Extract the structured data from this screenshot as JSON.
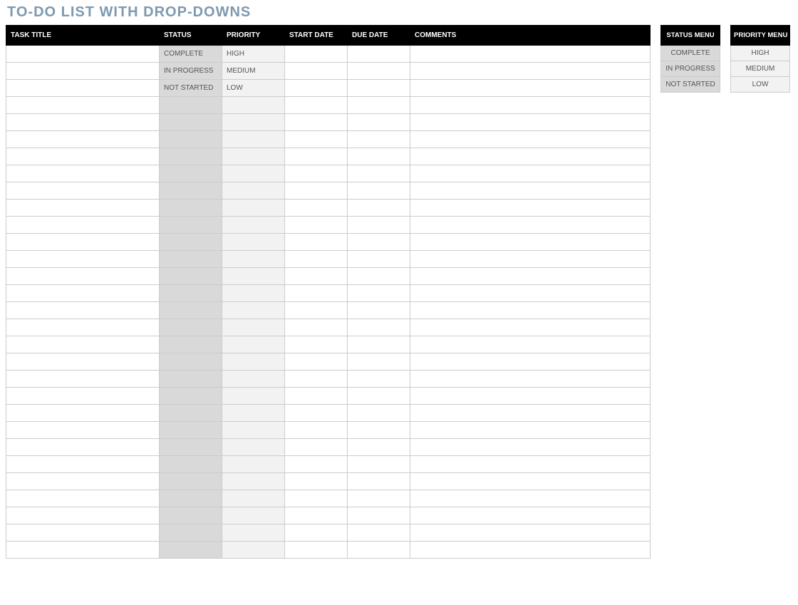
{
  "title": "TO-DO LIST WITH DROP-DOWNS",
  "main_table": {
    "headers": {
      "task": "TASK TITLE",
      "status": "STATUS",
      "priority": "PRIORITY",
      "start": "START DATE",
      "due": "DUE DATE",
      "comments": "COMMENTS"
    },
    "rows": [
      {
        "task": "",
        "status": "COMPLETE",
        "priority": "HIGH",
        "start": "",
        "due": "",
        "comments": ""
      },
      {
        "task": "",
        "status": "IN PROGRESS",
        "priority": "MEDIUM",
        "start": "",
        "due": "",
        "comments": ""
      },
      {
        "task": "",
        "status": "NOT STARTED",
        "priority": "LOW",
        "start": "",
        "due": "",
        "comments": ""
      },
      {
        "task": "",
        "status": "",
        "priority": "",
        "start": "",
        "due": "",
        "comments": ""
      },
      {
        "task": "",
        "status": "",
        "priority": "",
        "start": "",
        "due": "",
        "comments": ""
      },
      {
        "task": "",
        "status": "",
        "priority": "",
        "start": "",
        "due": "",
        "comments": ""
      },
      {
        "task": "",
        "status": "",
        "priority": "",
        "start": "",
        "due": "",
        "comments": ""
      },
      {
        "task": "",
        "status": "",
        "priority": "",
        "start": "",
        "due": "",
        "comments": ""
      },
      {
        "task": "",
        "status": "",
        "priority": "",
        "start": "",
        "due": "",
        "comments": ""
      },
      {
        "task": "",
        "status": "",
        "priority": "",
        "start": "",
        "due": "",
        "comments": ""
      },
      {
        "task": "",
        "status": "",
        "priority": "",
        "start": "",
        "due": "",
        "comments": ""
      },
      {
        "task": "",
        "status": "",
        "priority": "",
        "start": "",
        "due": "",
        "comments": ""
      },
      {
        "task": "",
        "status": "",
        "priority": "",
        "start": "",
        "due": "",
        "comments": ""
      },
      {
        "task": "",
        "status": "",
        "priority": "",
        "start": "",
        "due": "",
        "comments": ""
      },
      {
        "task": "",
        "status": "",
        "priority": "",
        "start": "",
        "due": "",
        "comments": ""
      },
      {
        "task": "",
        "status": "",
        "priority": "",
        "start": "",
        "due": "",
        "comments": ""
      },
      {
        "task": "",
        "status": "",
        "priority": "",
        "start": "",
        "due": "",
        "comments": ""
      },
      {
        "task": "",
        "status": "",
        "priority": "",
        "start": "",
        "due": "",
        "comments": ""
      },
      {
        "task": "",
        "status": "",
        "priority": "",
        "start": "",
        "due": "",
        "comments": ""
      },
      {
        "task": "",
        "status": "",
        "priority": "",
        "start": "",
        "due": "",
        "comments": ""
      },
      {
        "task": "",
        "status": "",
        "priority": "",
        "start": "",
        "due": "",
        "comments": ""
      },
      {
        "task": "",
        "status": "",
        "priority": "",
        "start": "",
        "due": "",
        "comments": ""
      },
      {
        "task": "",
        "status": "",
        "priority": "",
        "start": "",
        "due": "",
        "comments": ""
      },
      {
        "task": "",
        "status": "",
        "priority": "",
        "start": "",
        "due": "",
        "comments": ""
      },
      {
        "task": "",
        "status": "",
        "priority": "",
        "start": "",
        "due": "",
        "comments": ""
      },
      {
        "task": "",
        "status": "",
        "priority": "",
        "start": "",
        "due": "",
        "comments": ""
      },
      {
        "task": "",
        "status": "",
        "priority": "",
        "start": "",
        "due": "",
        "comments": ""
      },
      {
        "task": "",
        "status": "",
        "priority": "",
        "start": "",
        "due": "",
        "comments": ""
      },
      {
        "task": "",
        "status": "",
        "priority": "",
        "start": "",
        "due": "",
        "comments": ""
      },
      {
        "task": "",
        "status": "",
        "priority": "",
        "start": "",
        "due": "",
        "comments": ""
      }
    ]
  },
  "status_menu": {
    "header": "STATUS MENU",
    "items": [
      "COMPLETE",
      "IN PROGRESS",
      "NOT STARTED"
    ]
  },
  "priority_menu": {
    "header": "PRIORITY MENU",
    "items": [
      "HIGH",
      "MEDIUM",
      "LOW"
    ]
  }
}
